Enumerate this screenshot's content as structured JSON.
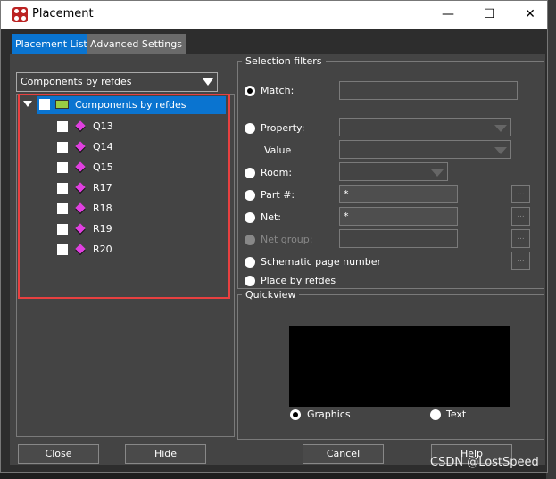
{
  "window": {
    "title": "Placement",
    "controls": [
      "minimize",
      "maximize",
      "close"
    ]
  },
  "tabs": [
    {
      "label": "Placement List",
      "active": true
    },
    {
      "label": "Advanced Settings",
      "active": false
    }
  ],
  "list_combo": {
    "value": "Components by refdes"
  },
  "tree": {
    "root": {
      "label": "Components by refdes",
      "checked": false,
      "expanded": true,
      "selected": true,
      "icon": "folder-icon"
    },
    "items": [
      {
        "label": "Q13",
        "icon": "component-diamond-icon"
      },
      {
        "label": "Q14",
        "icon": "component-diamond-icon"
      },
      {
        "label": "Q15",
        "icon": "component-diamond-icon"
      },
      {
        "label": "R17",
        "icon": "component-diamond-icon"
      },
      {
        "label": "R18",
        "icon": "component-diamond-icon"
      },
      {
        "label": "R19",
        "icon": "component-diamond-icon"
      },
      {
        "label": "R20",
        "icon": "component-diamond-icon"
      }
    ]
  },
  "filters": {
    "title": "Selection filters",
    "match": {
      "label": "Match:",
      "value": "",
      "selected": true
    },
    "property": {
      "label": "Property:",
      "value": ""
    },
    "value_label": "Value",
    "room": {
      "label": "Room:",
      "value": ""
    },
    "part": {
      "label": "Part #:",
      "value": "*"
    },
    "net": {
      "label": "Net:",
      "value": "*"
    },
    "net_group": {
      "label": "Net group:",
      "value": "",
      "disabled": true
    },
    "schematic": {
      "label": "Schematic page number"
    },
    "refdes": {
      "label": "Place by refdes"
    },
    "browse": "..."
  },
  "quickview": {
    "title": "Quickview",
    "graphics": "Graphics",
    "text": "Text",
    "selected": "Graphics"
  },
  "buttons": {
    "close": "Close",
    "hide": "Hide",
    "cancel": "Cancel",
    "help": "Help"
  },
  "watermark": "CSDN @LostSpeed",
  "colors": {
    "accent": "#0a74d0",
    "highlight_box": "#e84040",
    "component_icon": "#e040e0"
  }
}
